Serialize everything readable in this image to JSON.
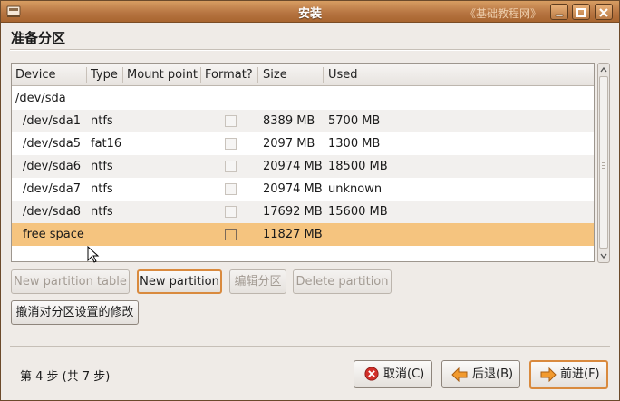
{
  "window": {
    "title": "安装",
    "watermark": "《基础教程网》",
    "controls": [
      "minimize-icon",
      "maximize-icon",
      "close-icon"
    ]
  },
  "page": {
    "heading": "准备分区"
  },
  "table": {
    "columns": [
      "Device",
      "Type",
      "Mount point",
      "Format?",
      "Size",
      "Used"
    ],
    "rows": [
      {
        "device": "/dev/sda",
        "type": "",
        "mount": "",
        "format": false,
        "size": "",
        "used": "",
        "is_disk": true
      },
      {
        "device": "/dev/sda1",
        "type": "ntfs",
        "mount": "",
        "format": false,
        "size": "8389 MB",
        "used": "5700 MB"
      },
      {
        "device": "/dev/sda5",
        "type": "fat16",
        "mount": "",
        "format": false,
        "size": "2097 MB",
        "used": "1300 MB"
      },
      {
        "device": "/dev/sda6",
        "type": "ntfs",
        "mount": "",
        "format": false,
        "size": "20974 MB",
        "used": "18500 MB"
      },
      {
        "device": "/dev/sda7",
        "type": "ntfs",
        "mount": "",
        "format": false,
        "size": "20974 MB",
        "used": "unknown"
      },
      {
        "device": "/dev/sda8",
        "type": "ntfs",
        "mount": "",
        "format": false,
        "size": "17692 MB",
        "used": "15600 MB"
      },
      {
        "device": "free space",
        "type": "",
        "mount": "",
        "format": false,
        "size": "11827 MB",
        "used": "",
        "selected": true
      }
    ]
  },
  "partition_buttons": {
    "new_table": "New partition table",
    "new_partition": "New partition",
    "edit": "编辑分区",
    "delete": "Delete partition",
    "undo": "撤消对分区设置的修改"
  },
  "footer": {
    "step": "第 4 步 (共 7 步)",
    "cancel": "取消(C)",
    "back": "后退(B)",
    "forward": "前进(F)"
  },
  "colors": {
    "titlebar": "#b57340",
    "selection": "#f5c47f",
    "focus_ring": "#d98a3e"
  }
}
